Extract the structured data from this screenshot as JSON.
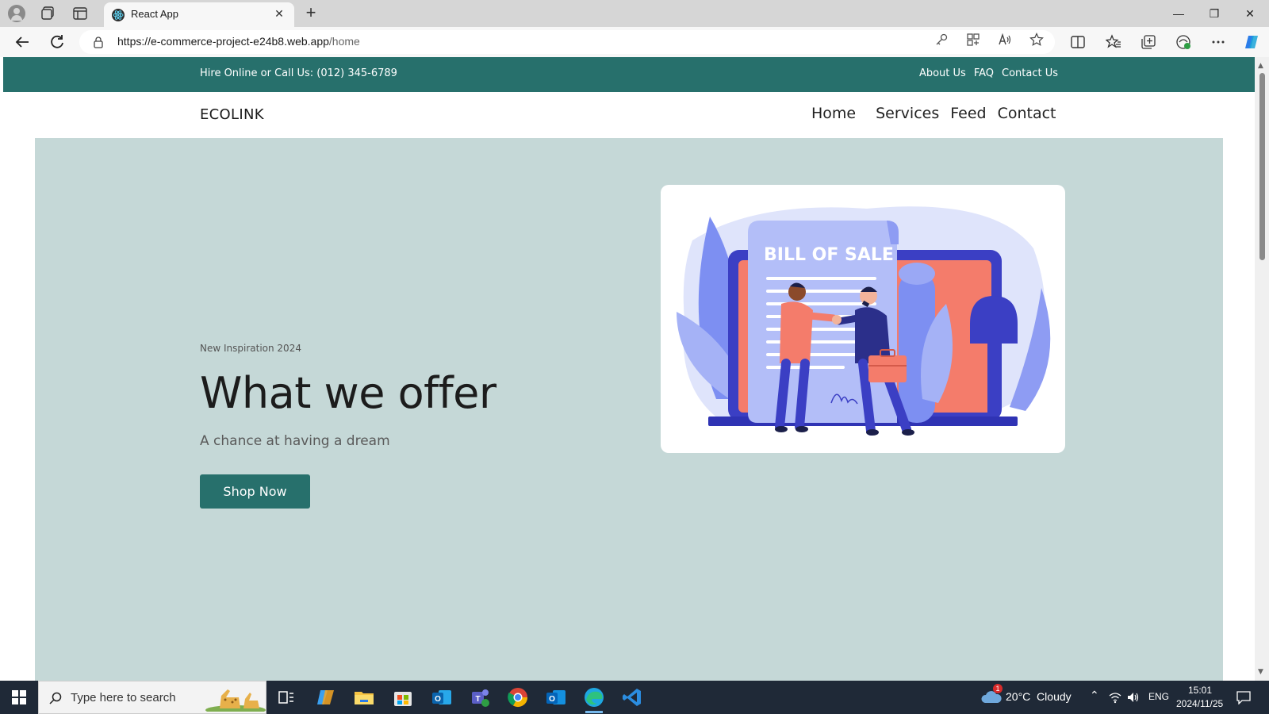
{
  "browser": {
    "tab_title": "React App",
    "new_tab": "+",
    "close_tab": "✕",
    "window_controls": {
      "minimize": "—",
      "restore": "❐",
      "close": "✕"
    },
    "url_host": "https://e-commerce-project-e24b8.web.app",
    "url_path": "/home"
  },
  "site": {
    "topbar": {
      "hire_text": "Hire Online or Call Us: (012) 345-6789",
      "links": [
        "About Us",
        "FAQ",
        "Contact Us"
      ]
    },
    "brand": "ECOLINK",
    "nav": [
      "Home",
      "Services",
      "Feed",
      "Contact"
    ],
    "hero": {
      "kicker": "New Inspiration 2024",
      "headline": "What we offer",
      "subheading": "A chance at having a dream",
      "cta_label": "Shop Now",
      "illustration_text": "BILL OF SALE"
    }
  },
  "taskbar": {
    "search_placeholder": "Type here to search",
    "weather": "20°C  Cloudy",
    "weather_badge": "1",
    "language": "ENG",
    "time": "15:01",
    "date": "2024/11/25"
  },
  "colors": {
    "brand_teal": "#27706c",
    "hero_bg": "#c5d8d7",
    "illustration_blue": "#6b7ff0",
    "illustration_coral": "#f47c6b",
    "taskbar": "#1f2937"
  }
}
